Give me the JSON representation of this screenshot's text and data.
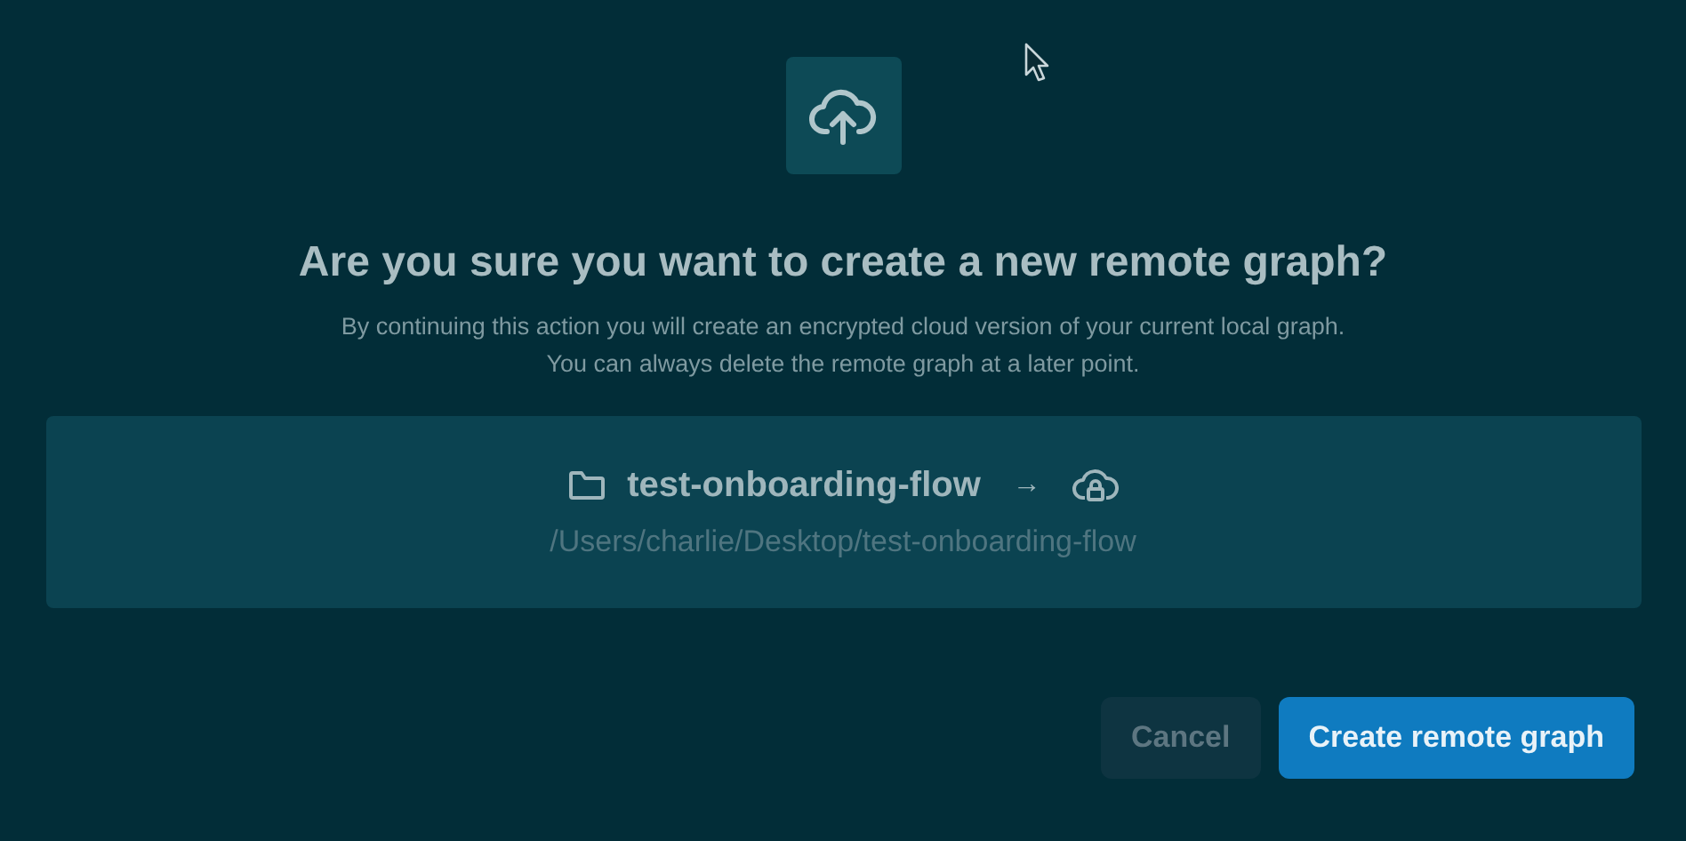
{
  "dialog": {
    "title": "Are you sure you want to create a new remote graph?",
    "description": [
      "By continuing this action you will create an encrypted cloud version of your current local graph.",
      "You can always delete the remote graph at a later point."
    ],
    "graph": {
      "name": "test-onboarding-flow",
      "arrow": "→",
      "path": "/Users/charlie/Desktop/test-onboarding-flow"
    },
    "buttons": [
      {
        "label": "Cancel",
        "kind": "secondary"
      },
      {
        "label": "Create remote graph",
        "kind": "primary"
      }
    ]
  }
}
